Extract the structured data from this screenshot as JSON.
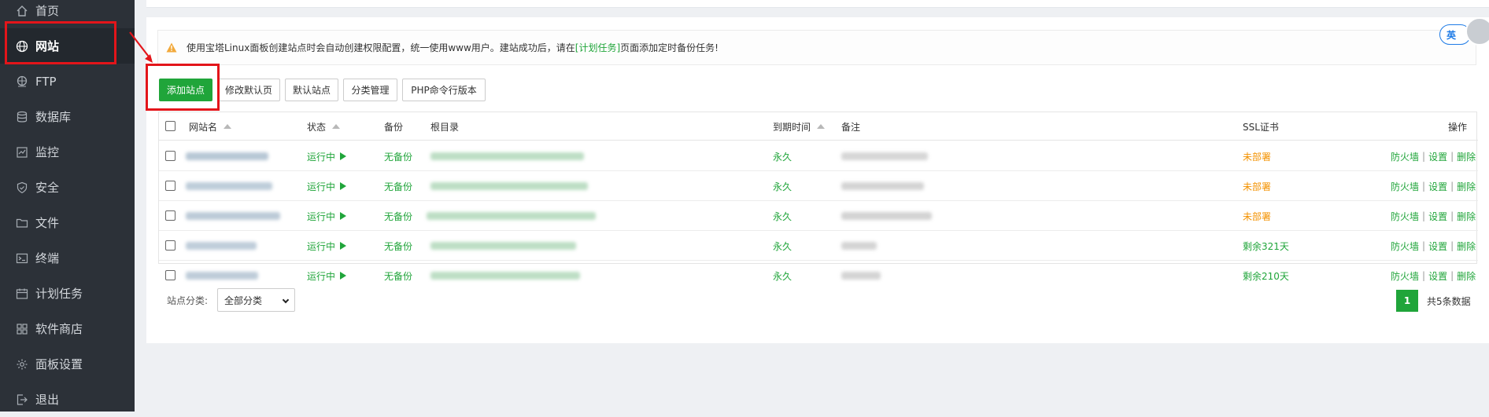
{
  "sidebar": {
    "items": [
      {
        "label": "首页",
        "icon": "home-icon",
        "active": false
      },
      {
        "label": "网站",
        "icon": "globe-icon",
        "active": true
      },
      {
        "label": "FTP",
        "icon": "ftp-icon",
        "active": false
      },
      {
        "label": "数据库",
        "icon": "database-icon",
        "active": false
      },
      {
        "label": "监控",
        "icon": "monitor-icon",
        "active": false
      },
      {
        "label": "安全",
        "icon": "shield-icon",
        "active": false
      },
      {
        "label": "文件",
        "icon": "folder-icon",
        "active": false
      },
      {
        "label": "终端",
        "icon": "terminal-icon",
        "active": false
      },
      {
        "label": "计划任务",
        "icon": "calendar-icon",
        "active": false
      },
      {
        "label": "软件商店",
        "icon": "apps-icon",
        "active": false
      },
      {
        "label": "面板设置",
        "icon": "gear-icon",
        "active": false
      },
      {
        "label": "退出",
        "icon": "logout-icon",
        "active": false
      }
    ]
  },
  "alert": {
    "text_before": "使用宝塔Linux面板创建站点时会自动创建权限配置，统一使用www用户。建站成功后，请在",
    "link": "[计划任务]",
    "text_after": "页面添加定时备份任务!"
  },
  "toolbar": {
    "add_site": "添加站点",
    "modify_default_page": "修改默认页",
    "default_site": "默认站点",
    "category_manage": "分类管理",
    "php_cli_version": "PHP命令行版本"
  },
  "table": {
    "headers": {
      "site_name": "网站名",
      "status": "状态",
      "backup": "备份",
      "root_dir": "根目录",
      "expiry": "到期时间",
      "remark": "备注",
      "ssl": "SSL证书",
      "actions": "操作"
    },
    "rows": [
      {
        "status": "运行中",
        "backup": "无备份",
        "expiry": "永久",
        "ssl": "未部署",
        "ssl_color": "#f39200"
      },
      {
        "status": "运行中",
        "backup": "无备份",
        "expiry": "永久",
        "ssl": "未部署",
        "ssl_color": "#f39200"
      },
      {
        "status": "运行中",
        "backup": "无备份",
        "expiry": "永久",
        "ssl": "未部署",
        "ssl_color": "#f39200"
      },
      {
        "status": "运行中",
        "backup": "无备份",
        "expiry": "永久",
        "ssl": "剩余321天",
        "ssl_color": "#20a53a"
      },
      {
        "status": "运行中",
        "backup": "无备份",
        "expiry": "永久",
        "ssl": "剩余210天",
        "ssl_color": "#20a53a"
      }
    ],
    "row_actions": {
      "firewall": "防火墙",
      "settings": "设置",
      "delete": "删除",
      "separator": "|"
    }
  },
  "footer": {
    "category_label": "站点分类:",
    "category_selected": "全部分类",
    "current_page": "1",
    "total": "共5条数据"
  },
  "lang_toggle": "英",
  "colors": {
    "accent": "#20a53a",
    "warning": "#f39200",
    "sidebar_bg": "#2c3138",
    "highlight": "#e3151a"
  }
}
